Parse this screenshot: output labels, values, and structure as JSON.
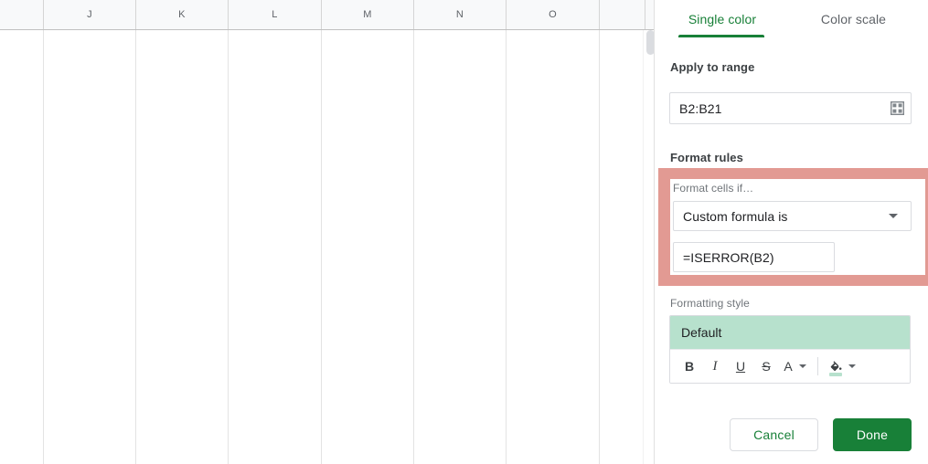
{
  "spreadsheet": {
    "columns": [
      "",
      "J",
      "K",
      "L",
      "M",
      "N",
      "O",
      ""
    ],
    "scrollbar_name": "vertical-scrollbar"
  },
  "panel": {
    "tabs": [
      {
        "label": "Single color",
        "active": true
      },
      {
        "label": "Color scale",
        "active": false
      }
    ],
    "apply_to_range": {
      "label": "Apply to range",
      "value": "B2:B21",
      "icon": "grid-select-icon"
    },
    "format_rules": {
      "label": "Format rules",
      "condition_label": "Format cells if…",
      "condition_value": "Custom formula is",
      "formula_value": "=ISERROR(B2)",
      "highlight_color": "#e29a93"
    },
    "formatting_style": {
      "label": "Formatting style",
      "preview_text": "Default",
      "preview_bg": "#b7e1cd",
      "toolbar": [
        {
          "name": "bold-button",
          "glyph": "B"
        },
        {
          "name": "italic-button",
          "glyph": "I"
        },
        {
          "name": "underline-button",
          "glyph": "U"
        },
        {
          "name": "strikethrough-button",
          "glyph": "S"
        },
        {
          "name": "text-color-button",
          "glyph": "A"
        },
        {
          "name": "fill-color-button",
          "glyph": "fill-bucket-icon"
        }
      ],
      "fill_swatch_color": "#b7e1cd"
    },
    "buttons": {
      "cancel": "Cancel",
      "done": "Done"
    },
    "accent_color": "#188038"
  }
}
